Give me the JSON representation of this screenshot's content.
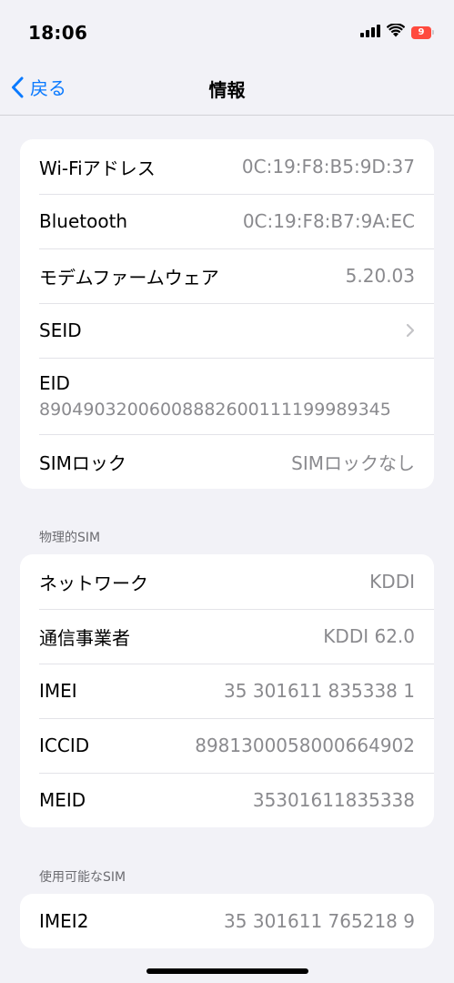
{
  "status_bar": {
    "time": "18:06",
    "battery_level": "9",
    "battery_color": "#ff4b3e"
  },
  "nav": {
    "back_label": "戻る",
    "title": "情報",
    "accent_color": "#0a7aff"
  },
  "groups": {
    "device": {
      "rows": [
        {
          "label": "Wi-Fiアドレス",
          "value": "0C:19:F8:B5:9D:37"
        },
        {
          "label": "Bluetooth",
          "value": "0C:19:F8:B7:9A:EC"
        },
        {
          "label": "モデムファームウェア",
          "value": "5.20.03"
        },
        {
          "label": "SEID",
          "icon": "chevron-right-icon"
        },
        {
          "label": "EID",
          "value": "89049032006008882600111199989345"
        },
        {
          "label": "SIMロック",
          "value": "SIMロックなし"
        }
      ]
    },
    "physical_sim": {
      "header": "物理的SIM",
      "rows": [
        {
          "label": "ネットワーク",
          "value": "KDDI"
        },
        {
          "label": "通信事業者",
          "value": "KDDI 62.0"
        },
        {
          "label": "IMEI",
          "value": "35 301611 835338 1"
        },
        {
          "label": "ICCID",
          "value": "8981300058000664902"
        },
        {
          "label": "MEID",
          "value": "35301611835338"
        }
      ]
    },
    "available_sim": {
      "header": "使用可能なSIM",
      "rows": [
        {
          "label": "IMEI2",
          "value": "35 301611 765218 9"
        }
      ]
    }
  }
}
